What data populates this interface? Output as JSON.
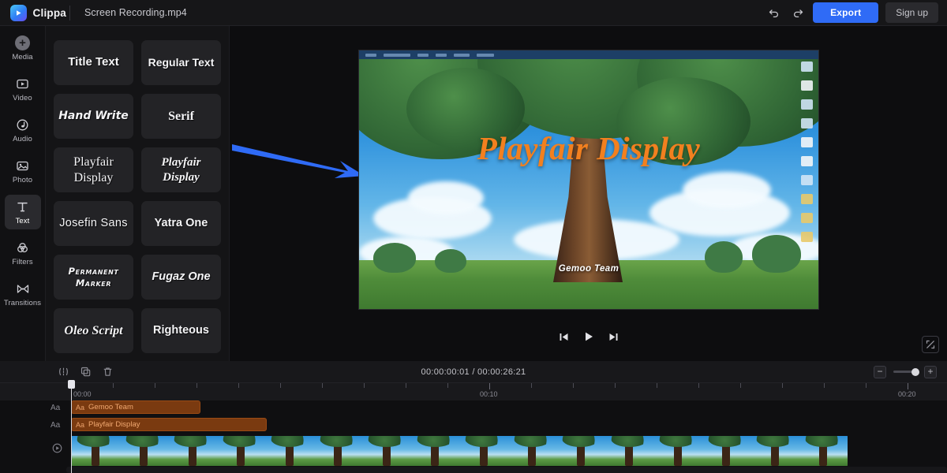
{
  "app": {
    "brand": "Clippa",
    "document_title": "Screen Recording.mp4"
  },
  "topbar": {
    "undo_icon": "undo-arrow-icon",
    "redo_icon": "redo-arrow-icon",
    "export_label": "Export",
    "signup_label": "Sign up",
    "export_color": "#2f6bf6"
  },
  "sidebar": {
    "items": [
      {
        "label": "Media",
        "icon": "plus-circle-icon",
        "active": false
      },
      {
        "label": "Video",
        "icon": "video-play-box-icon",
        "active": false
      },
      {
        "label": "Audio",
        "icon": "audio-note-circle-icon",
        "active": false
      },
      {
        "label": "Photo",
        "icon": "photo-image-icon",
        "active": false
      },
      {
        "label": "Text",
        "icon": "text-t-icon",
        "active": true
      },
      {
        "label": "Filters",
        "icon": "filters-circles-icon",
        "active": false
      },
      {
        "label": "Transitions",
        "icon": "transitions-bowtie-icon",
        "active": false
      }
    ]
  },
  "font_panel": {
    "cards": [
      {
        "label": "Title Text",
        "style": "f-title"
      },
      {
        "label": "Regular Text",
        "style": "f-regular"
      },
      {
        "label": "Hand Write",
        "style": "f-hand"
      },
      {
        "label": "Serif",
        "style": "f-serif"
      },
      {
        "label": "Playfair Display",
        "style": "f-play"
      },
      {
        "label": "Playfair Display",
        "style": "f-play-i"
      },
      {
        "label": "Josefin Sans",
        "style": "f-josefin"
      },
      {
        "label": "Yatra One",
        "style": "f-yatra"
      },
      {
        "label": "Permanent Marker",
        "style": "f-perm"
      },
      {
        "label": "Fugaz One",
        "style": "f-fugaz"
      },
      {
        "label": "Oleo Script",
        "style": "f-oleo"
      },
      {
        "label": "Righteous",
        "style": "f-right"
      }
    ]
  },
  "preview": {
    "overlay_title": "Playfair Display",
    "overlay_title_color": "#f2801f",
    "overlay_subtitle": "Gemoo Team",
    "annotation_arrow_color": "#2f6bf6",
    "transport": {
      "prev_icon": "skip-previous-icon",
      "play_icon": "play-icon",
      "next_icon": "skip-next-icon"
    },
    "fullscreen_icon": "fullscreen-expand-icon"
  },
  "timeline": {
    "tools": [
      {
        "name": "split",
        "icon": "split-clip-icon"
      },
      {
        "name": "duplicate",
        "icon": "duplicate-icon"
      },
      {
        "name": "delete",
        "icon": "trash-icon"
      }
    ],
    "current_time": "00:00:00:01",
    "total_time": "00:00:26:21",
    "time_display": "00:00:00:01 / 00:00:26:21",
    "zoom": {
      "minus_label": "−",
      "plus_label": "+"
    },
    "ruler_labels": [
      "00:00",
      "00:10",
      "00:20"
    ],
    "tracks": [
      {
        "type": "text",
        "icon": "text-track-icon",
        "clip_label": "Gemoo Team",
        "clip_color": "#7a3a10"
      },
      {
        "type": "text",
        "icon": "text-track-icon",
        "clip_label": "Playfair Display",
        "clip_color": "#7a3a10"
      },
      {
        "type": "video",
        "icon": "video-track-icon",
        "clip_label": ""
      }
    ]
  }
}
